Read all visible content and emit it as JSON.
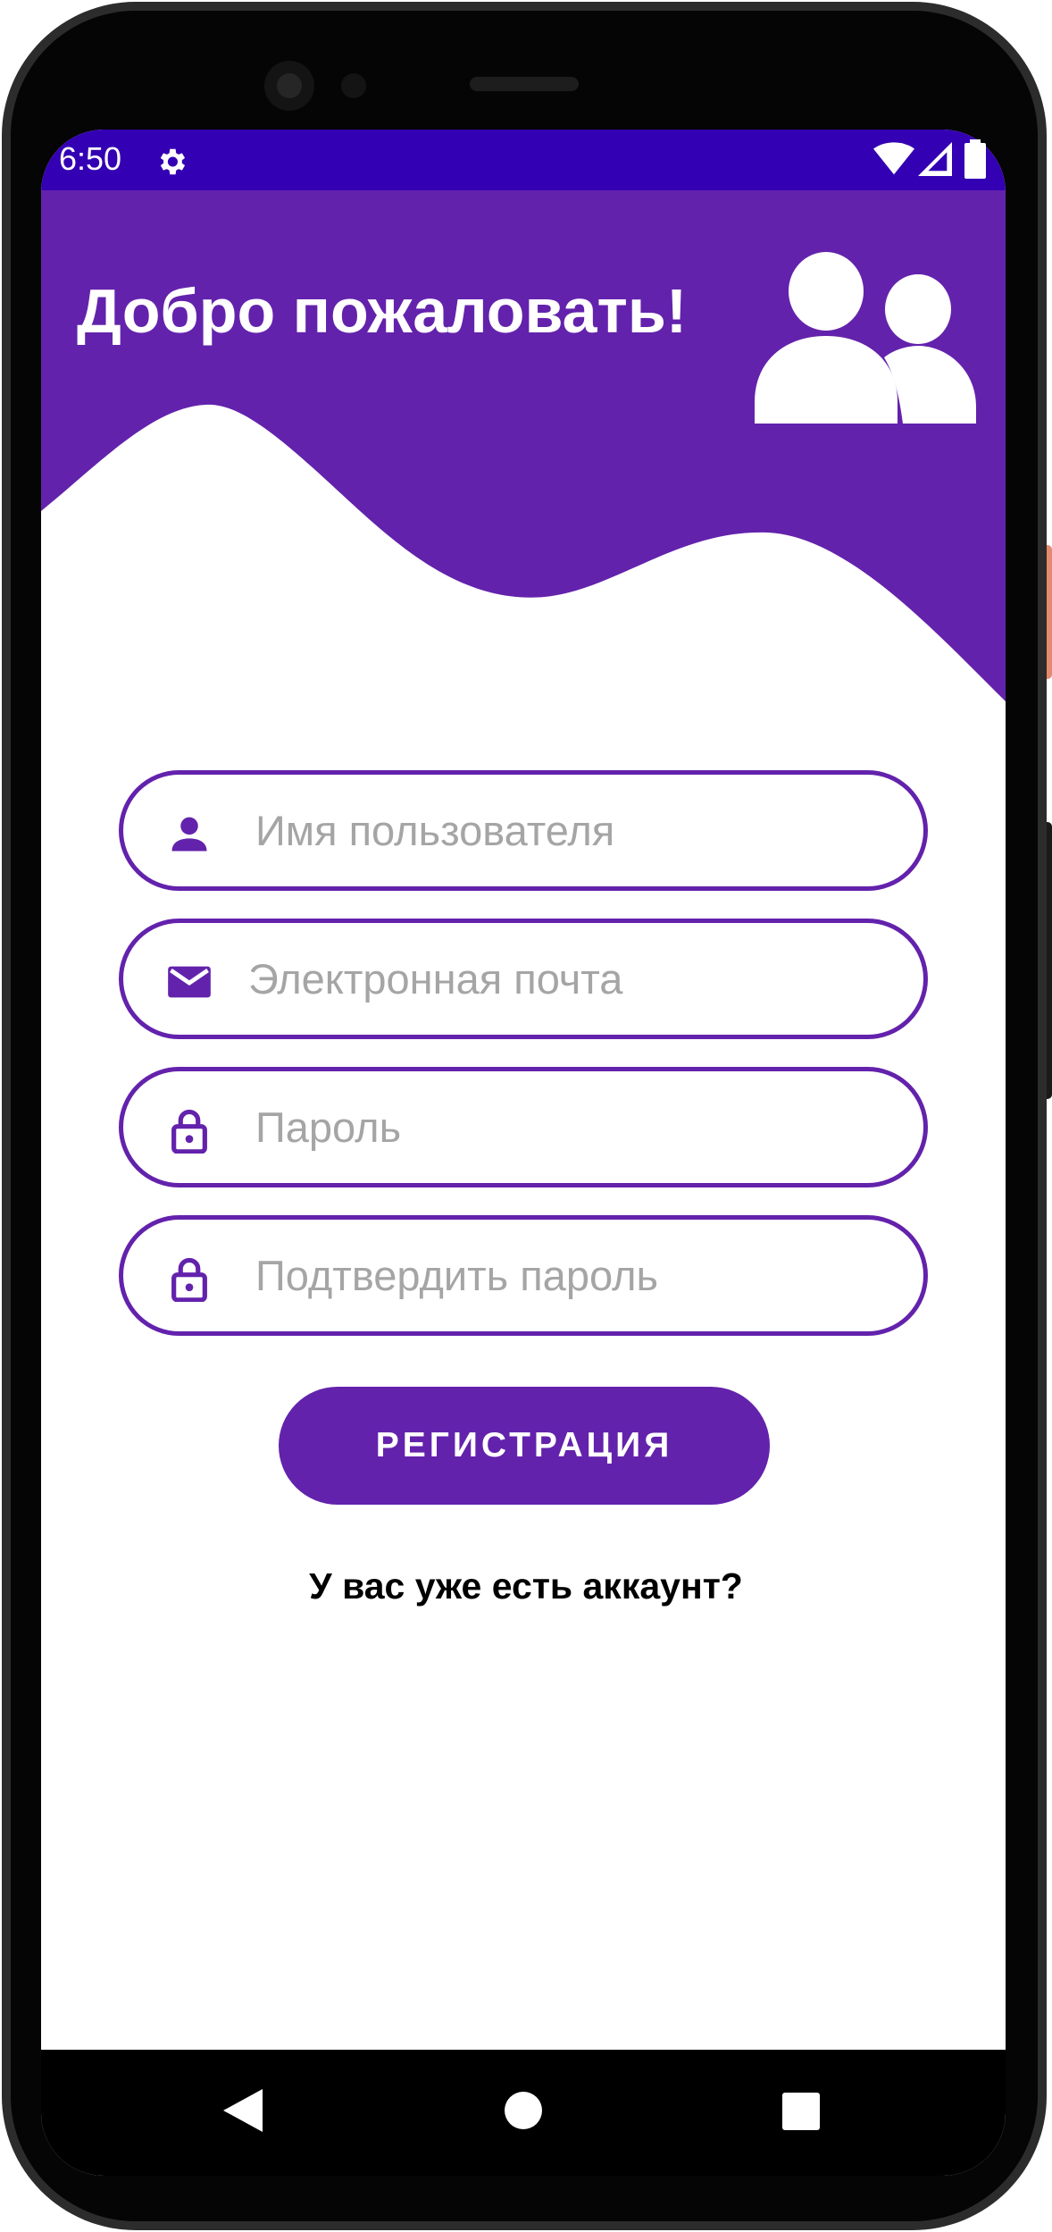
{
  "status_bar": {
    "time": "6:50",
    "background": "#3400b3",
    "icons": [
      "gear-icon",
      "wifi-icon",
      "signal-icon",
      "battery-icon"
    ]
  },
  "header": {
    "title": "Добро пожаловать!",
    "background": "#6322ac",
    "illustration": "users-icon"
  },
  "form": {
    "fields": [
      {
        "icon": "person-icon",
        "placeholder": "Имя пользователя"
      },
      {
        "icon": "mail-icon",
        "placeholder": "Электронная почта"
      },
      {
        "icon": "lock-icon",
        "placeholder": "Пароль"
      },
      {
        "icon": "lock-icon",
        "placeholder": "Подтвердить пароль"
      }
    ],
    "register_label": "РЕГИСТРАЦИЯ",
    "login_link": "У вас уже есть аккаунт?",
    "accent": "#6322ac",
    "placeholder_color": "#a5a5a5"
  },
  "nav_bar": {
    "icons": [
      "back-icon",
      "home-icon",
      "recents-icon"
    ]
  }
}
